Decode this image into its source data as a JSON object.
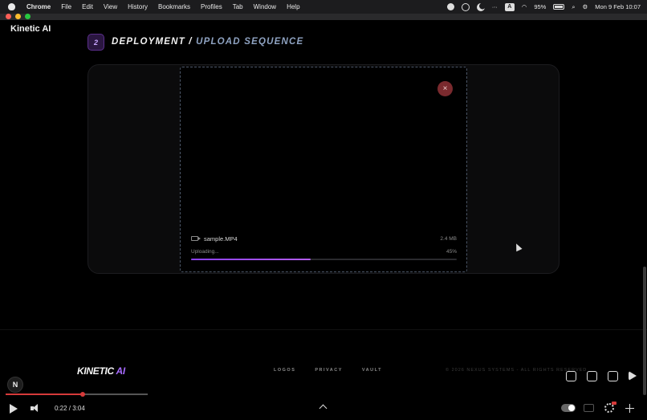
{
  "menubar": {
    "apple_icon": "apple-logo-icon",
    "items": [
      "Chrome",
      "File",
      "Edit",
      "View",
      "History",
      "Bookmarks",
      "Profiles",
      "Tab",
      "Window",
      "Help"
    ],
    "battery": "95%",
    "datetime": "Mon 9 Feb  10:07"
  },
  "window": {
    "traffic_colors": [
      "#ff5f57",
      "#febc2e",
      "#28c840"
    ]
  },
  "app": {
    "brand": "Kinetic AI"
  },
  "step": {
    "number": "2",
    "title_primary": "DEPLOYMENT /",
    "title_secondary": "UPLOAD SEQUENCE"
  },
  "upload": {
    "close_label": "×",
    "file_name": "sample.MP4",
    "file_size": "2.4 MB",
    "status": "Uploading...",
    "percent_label": "45%",
    "progress": 0.45,
    "accent": "#9b4cf2"
  },
  "footer": {
    "logo_main": "KINETIC",
    "logo_accent": "AI",
    "links": [
      "LOGOS",
      "PRIVACY",
      "VAULT"
    ],
    "copyright": "© 2026 NEXUS SYSTEMS - ALL RIGHTS RESERVED"
  },
  "player": {
    "channel_initial": "N",
    "timecode": "0:22 / 3:04",
    "played_fraction": 0.54,
    "progress_color": "#d63a3a",
    "actions": [
      "thumbs-up-icon",
      "thumbs-down-icon",
      "comment-icon",
      "share-icon"
    ]
  }
}
